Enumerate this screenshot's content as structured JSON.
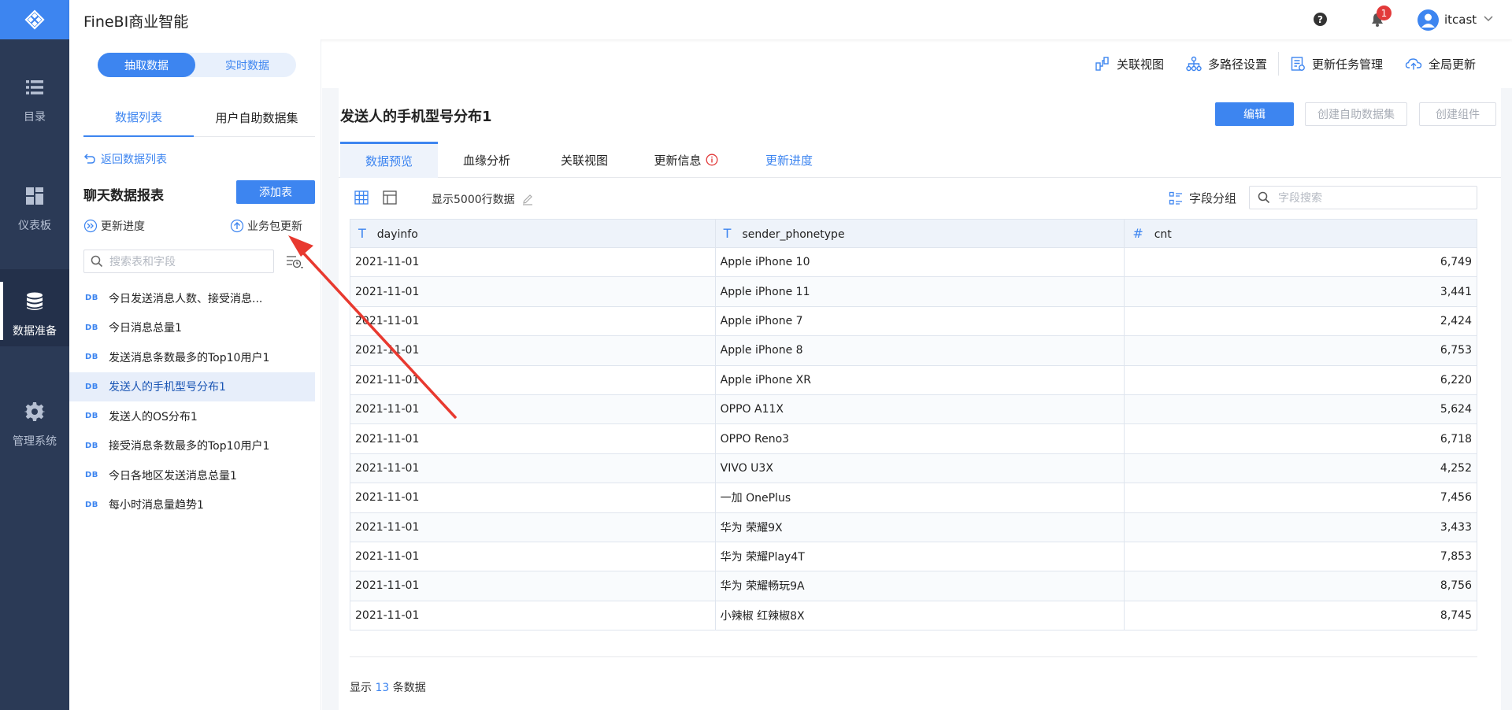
{
  "colors": {
    "accent": "#3d85f0",
    "rail": "#2b3a56",
    "badge": "#e23a3a",
    "annotation": "#e8392f"
  },
  "nav": {
    "items": [
      {
        "label": "目录",
        "icon": "list-icon",
        "active": false
      },
      {
        "label": "仪表板",
        "icon": "dashboard-icon",
        "active": false
      },
      {
        "label": "数据准备",
        "icon": "database-icon",
        "active": true
      },
      {
        "label": "管理系统",
        "icon": "gear-icon",
        "active": false
      }
    ]
  },
  "header": {
    "app_title": "FineBI商业智能",
    "help_glyph": "?",
    "notification_count": "1",
    "username": "itcast"
  },
  "left_panel": {
    "mode_toggle": {
      "active": "抽取数据",
      "inactive": "实时数据"
    },
    "tabs": [
      {
        "label": "数据列表"
      },
      {
        "label": "用户自助数据集"
      }
    ],
    "back_link": "返回数据列表",
    "package_title": "聊天数据报表",
    "add_table": "添加表",
    "update_progress": "更新进度",
    "package_update": "业务包更新",
    "search_placeholder": "搜索表和字段",
    "db_tag": "DB",
    "tables": [
      "今日发送消息人数、接受消息...",
      "今日消息总量1",
      "发送消息条数最多的Top10用户1",
      "发送人的手机型号分布1",
      "发送人的OS分布1",
      "接受消息条数最多的Top10用户1",
      "今日各地区发送消息总量1",
      "每小时消息量趋势1"
    ],
    "selected_table": "发送人的手机型号分布1"
  },
  "toolbar": {
    "related_view": "关联视图",
    "multipath": "多路径设置",
    "update_tasks": "更新任务管理",
    "global_update": "全局更新"
  },
  "main": {
    "title": "发送人的手机型号分布1",
    "edit": "编辑",
    "create_self_dataset": "创建自助数据集",
    "create_component": "创建组件",
    "tabs": [
      {
        "label": "数据预览",
        "state": "active"
      },
      {
        "label": "血缘分析",
        "state": "normal"
      },
      {
        "label": "关联视图",
        "state": "normal"
      },
      {
        "label": "更新信息",
        "state": "warning"
      },
      {
        "label": "更新进度",
        "state": "link"
      }
    ],
    "show_rows": "显示5000行数据",
    "field_group": "字段分组",
    "field_search_placeholder": "字段搜索",
    "columns": [
      {
        "type_icon": "T",
        "name": "dayinfo"
      },
      {
        "type_icon": "T",
        "name": "sender_phonetype"
      },
      {
        "type_icon": "#",
        "name": "cnt"
      }
    ],
    "rows": [
      [
        "2021-11-01",
        "Apple iPhone 10",
        "6,749"
      ],
      [
        "2021-11-01",
        "Apple iPhone 11",
        "3,441"
      ],
      [
        "2021-11-01",
        "Apple iPhone 7",
        "2,424"
      ],
      [
        "2021-11-01",
        "Apple iPhone 8",
        "6,753"
      ],
      [
        "2021-11-01",
        "Apple iPhone XR",
        "6,220"
      ],
      [
        "2021-11-01",
        "OPPO A11X",
        "5,624"
      ],
      [
        "2021-11-01",
        "OPPO Reno3",
        "6,718"
      ],
      [
        "2021-11-01",
        "VIVO U3X",
        "4,252"
      ],
      [
        "2021-11-01",
        "一加 OnePlus",
        "7,456"
      ],
      [
        "2021-11-01",
        "华为 荣耀9X",
        "3,433"
      ],
      [
        "2021-11-01",
        "华为 荣耀Play4T",
        "7,853"
      ],
      [
        "2021-11-01",
        "华为 荣耀畅玩9A",
        "8,756"
      ],
      [
        "2021-11-01",
        "小辣椒 红辣椒8X",
        "8,745"
      ]
    ],
    "footer": {
      "prefix": "显示",
      "count": "13",
      "suffix": "条数据"
    }
  }
}
